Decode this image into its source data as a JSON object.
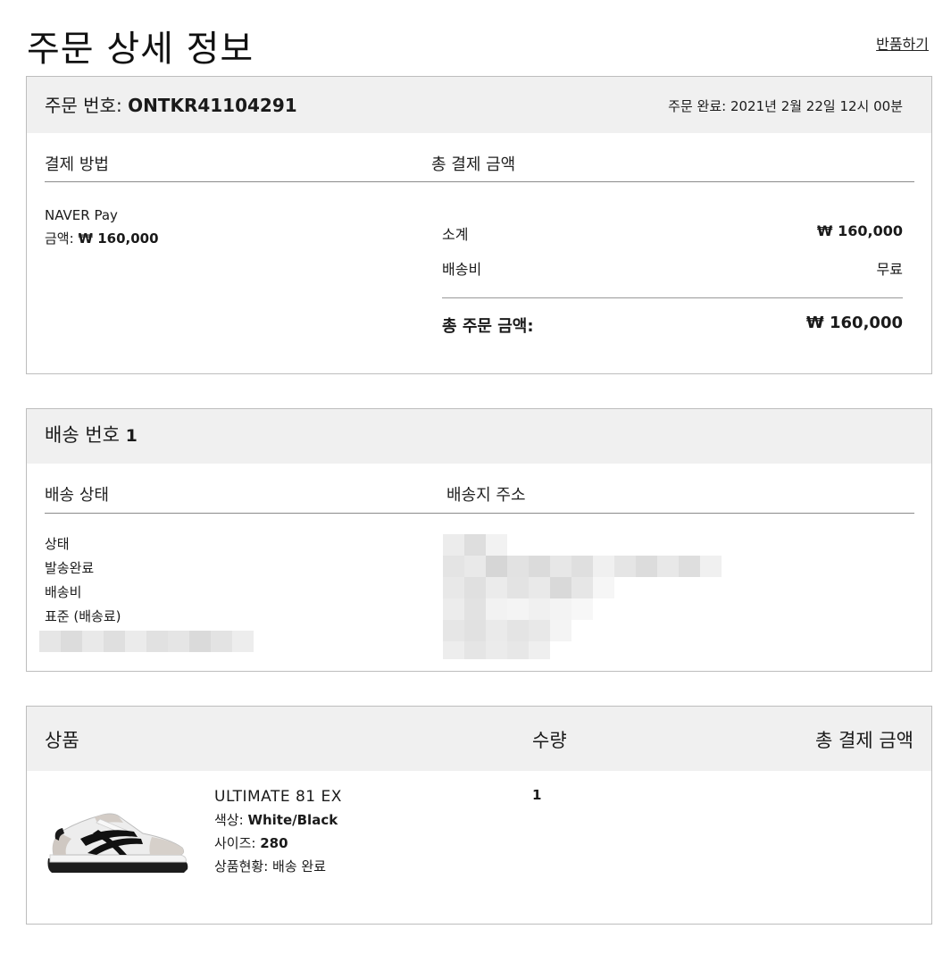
{
  "header": {
    "title": "주문 상세 정보",
    "return_link": "반품하기"
  },
  "order": {
    "number_label": "주문 번호: ",
    "number": "ONTKR41104291",
    "completed": "주문 완료: 2021년 2월 22일 12시 00분",
    "payment_method_header": "결제 방법",
    "total_payment_header": "총 결제 금액",
    "payment_method": "NAVER Pay",
    "amount_label": "금액: ",
    "amount": "₩ 160,000",
    "subtotal_label": "소계",
    "subtotal_value": "₩ 160,000",
    "shipping_label": "배송비",
    "shipping_value": "무료",
    "total_label": "총 주문 금액:",
    "total_value": "₩ 160,000"
  },
  "delivery": {
    "title_label": "배송 번호 ",
    "number": "1",
    "status_header": "배송 상태",
    "address_header": "배송지 주소",
    "status_items": [
      "상태",
      "발송완료",
      "배송비",
      "표준 (배송료)"
    ]
  },
  "product": {
    "col_product": "상품",
    "col_qty": "수량",
    "col_total": "총 결제 금액",
    "name": "ULTIMATE 81 EX",
    "color_label": "색상: ",
    "color": "White/Black",
    "size_label": "사이즈: ",
    "size": "280",
    "status_label": "상품현황: ",
    "status": "배송 완료",
    "quantity": "1"
  }
}
